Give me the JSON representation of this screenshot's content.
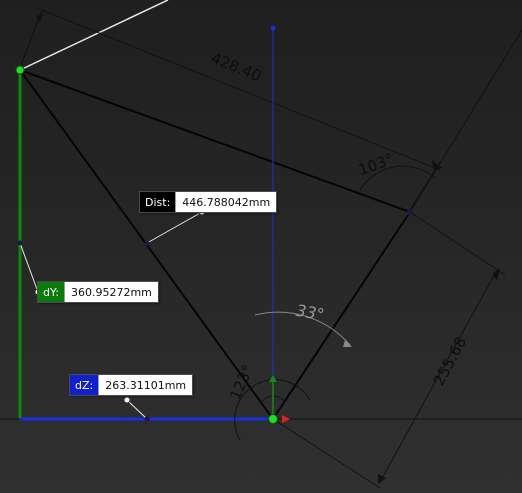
{
  "readouts": {
    "dist": {
      "label": "Dist:",
      "value": "446.788042mm",
      "color": "#000000"
    },
    "dy": {
      "label": "dY:",
      "value": "360.95272mm",
      "color": "#0a7a0a"
    },
    "dz": {
      "label": "dZ:",
      "value": "263.31101mm",
      "color": "#1020d0"
    }
  },
  "dimensions": {
    "length_top": "428.40",
    "length_right": "255.68",
    "angle_mid": "103°",
    "angle_gray": "33°",
    "angle_origin": "123°"
  },
  "colors": {
    "sketch_line": "#050505",
    "y_axis": "#0a8a0a",
    "z_axis": "#1530e0",
    "origin_point": "#22dd22",
    "axis_x_arrow": "#e02020",
    "white_line": "#e8e8e8"
  }
}
